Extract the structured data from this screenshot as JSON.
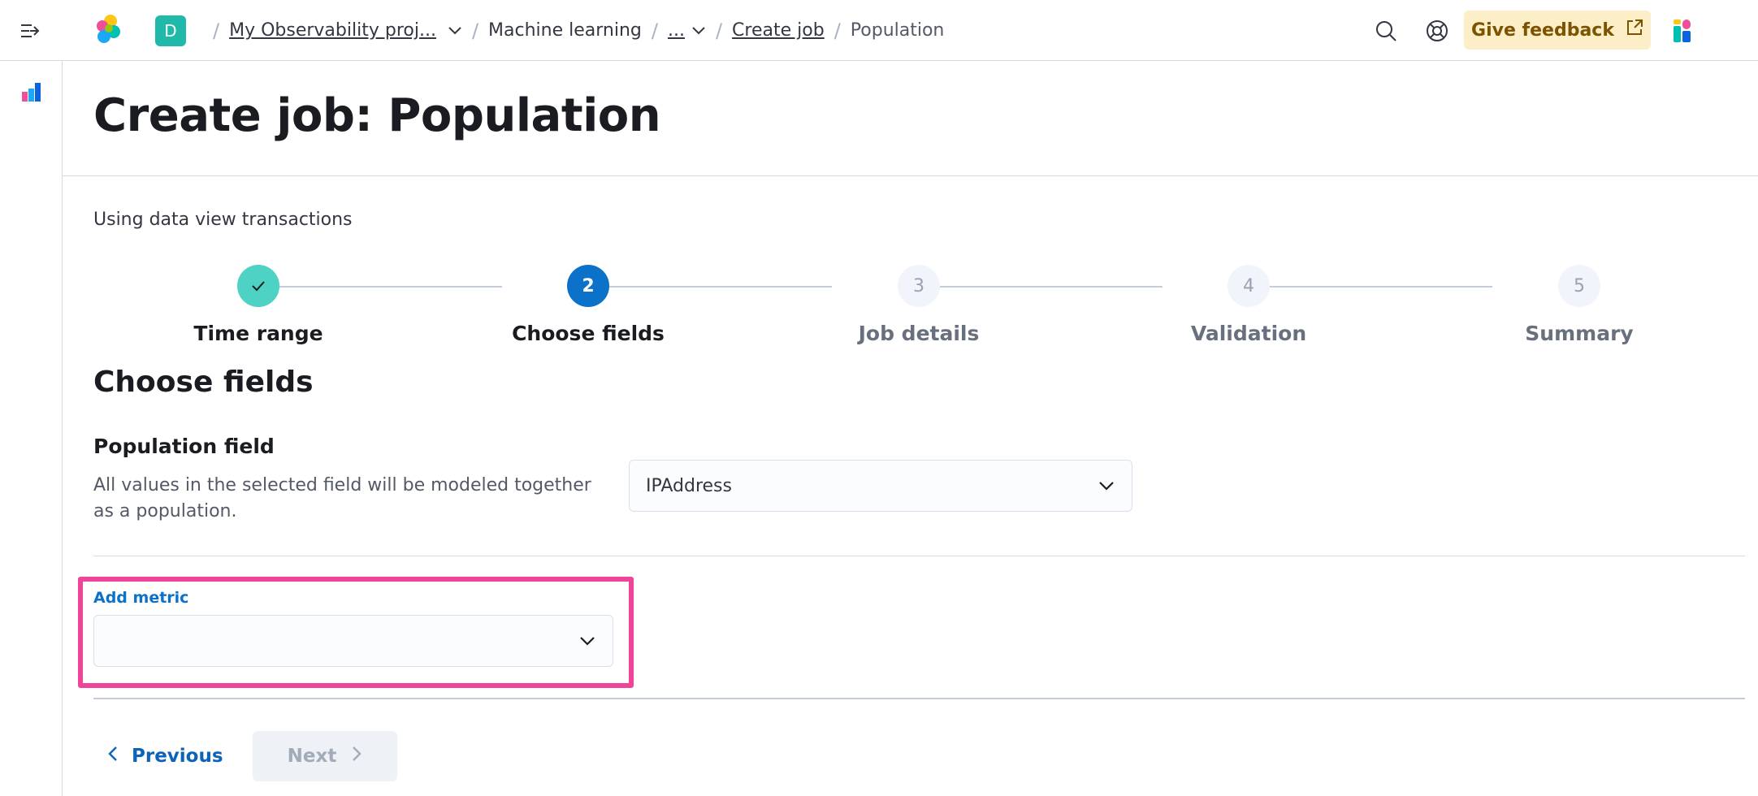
{
  "header": {
    "space_initial": "D",
    "breadcrumbs": {
      "project": "My Observability proj...",
      "ml": "Machine learning",
      "ellipsis": "...",
      "create_job": "Create job",
      "current": "Population"
    },
    "feedback_label": "Give feedback"
  },
  "page": {
    "title": "Create job: Population",
    "data_view_text": "Using data view transactions"
  },
  "stepper": {
    "steps": [
      {
        "label": "Time range",
        "number": "",
        "status": "complete"
      },
      {
        "label": "Choose fields",
        "number": "2",
        "status": "current"
      },
      {
        "label": "Job details",
        "number": "3",
        "status": "incomplete"
      },
      {
        "label": "Validation",
        "number": "4",
        "status": "incomplete"
      },
      {
        "label": "Summary",
        "number": "5",
        "status": "incomplete"
      }
    ]
  },
  "choose_fields": {
    "section_title": "Choose fields",
    "population_field": {
      "title": "Population field",
      "description": "All values in the selected field will be modeled together as a population.",
      "selected": "IPAddress"
    },
    "add_metric": {
      "label": "Add metric",
      "selected": ""
    }
  },
  "footer": {
    "previous_label": "Previous",
    "next_label": "Next"
  },
  "colors": {
    "primary": "#0b71c9",
    "success": "#4dd2c4",
    "highlight": "#f0449a",
    "feedback_bg": "#fcefc7"
  },
  "icons": [
    "menu-toggle-icon",
    "elastic-logo-icon",
    "chevron-down-icon",
    "search-icon",
    "help-icon",
    "external-link-icon",
    "app-logo-icon",
    "ml-app-icon",
    "check-icon",
    "chevron-left-icon",
    "chevron-right-icon"
  ]
}
